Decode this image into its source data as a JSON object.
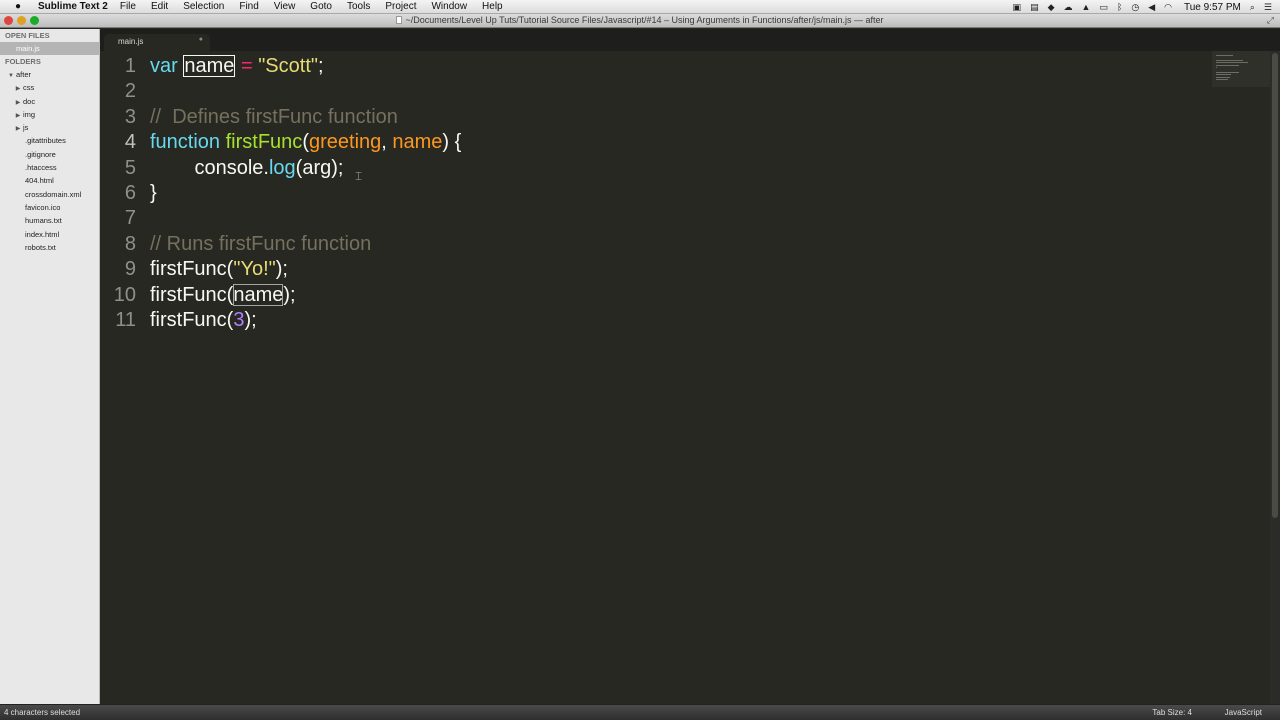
{
  "menubar": {
    "app_name": "Sublime Text 2",
    "items": [
      "File",
      "Edit",
      "Selection",
      "Find",
      "View",
      "Goto",
      "Tools",
      "Project",
      "Window",
      "Help"
    ],
    "clock": "Tue 9:57 PM",
    "status_icons": [
      "video-icon",
      "disk-icon",
      "audio-icon",
      "cloud-icon",
      "drive-icon",
      "battery-icon",
      "bluetooth-icon",
      "time-machine-icon",
      "volume-icon",
      "wifi-icon",
      "search-icon",
      "list-icon"
    ]
  },
  "window": {
    "title": "~/Documents/Level Up Tuts/Tutorial Source Files/Javascript/#14 – Using Arguments in Functions/after/js/main.js — after"
  },
  "sidebar": {
    "open_files_heading": "OPEN FILES",
    "open_files": [
      "main.js"
    ],
    "folders_heading": "FOLDERS",
    "root_folder": "after",
    "subfolders": [
      "css",
      "doc",
      "img",
      "js"
    ],
    "files": [
      ".gitattributes",
      ".gitignore",
      ".htaccess",
      "404.html",
      "crossdomain.xml",
      "favicon.ico",
      "humans.txt",
      "index.html",
      "robots.txt"
    ]
  },
  "tab": {
    "label": "main.js",
    "close_glyph": "●"
  },
  "editor": {
    "lines": [
      {
        "num": "1",
        "tokens": [
          [
            "kw",
            "var"
          ],
          [
            "plain",
            " "
          ],
          [
            "selbox",
            "name"
          ],
          [
            "plain",
            " "
          ],
          [
            "op",
            "="
          ],
          [
            "plain",
            " "
          ],
          [
            "str",
            "\"Scott\""
          ],
          [
            "plain",
            ";"
          ]
        ]
      },
      {
        "num": "2",
        "tokens": []
      },
      {
        "num": "3",
        "tokens": [
          [
            "comment",
            "//  Defines firstFunc function"
          ]
        ]
      },
      {
        "num": "4",
        "tokens": [
          [
            "kw",
            "function"
          ],
          [
            "plain",
            " "
          ],
          [
            "fn",
            "firstFunc"
          ],
          [
            "plain",
            "("
          ],
          [
            "param",
            "greeting"
          ],
          [
            "plain",
            ", "
          ],
          [
            "param",
            "name"
          ],
          [
            "plain",
            ") {"
          ]
        ]
      },
      {
        "num": "5",
        "tokens": [
          [
            "plain",
            "        console."
          ],
          [
            "kw",
            "log"
          ],
          [
            "plain",
            "(arg);"
          ]
        ]
      },
      {
        "num": "6",
        "tokens": [
          [
            "plain",
            "}"
          ]
        ]
      },
      {
        "num": "7",
        "tokens": []
      },
      {
        "num": "8",
        "tokens": [
          [
            "comment",
            "// Runs firstFunc function"
          ]
        ]
      },
      {
        "num": "9",
        "tokens": [
          [
            "plain",
            "firstFunc("
          ],
          [
            "str",
            "\"Yo!\""
          ],
          [
            "plain",
            ");"
          ]
        ]
      },
      {
        "num": "10",
        "tokens": [
          [
            "plain",
            "firstFunc("
          ],
          [
            "matchbox",
            "name"
          ],
          [
            "plain",
            ");"
          ]
        ]
      },
      {
        "num": "11",
        "tokens": [
          [
            "plain",
            "firstFunc("
          ],
          [
            "num",
            "3"
          ],
          [
            "plain",
            ");"
          ]
        ]
      }
    ],
    "active_line": "4"
  },
  "statusbar": {
    "selection": "4 characters selected",
    "tab_size": "Tab Size: 4",
    "syntax": "JavaScript"
  },
  "colors": {
    "background": "#272822",
    "keyword": "#66d9ef",
    "function": "#a6e22e",
    "string": "#e6db74",
    "operator": "#f92672",
    "parameter": "#fd971f",
    "comment": "#75715e",
    "number": "#ae81ff"
  }
}
